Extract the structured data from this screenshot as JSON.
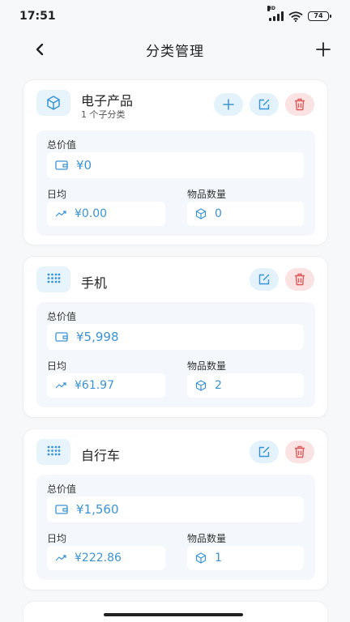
{
  "status": {
    "time": "17:51",
    "network": "HD",
    "battery": "74"
  },
  "header": {
    "title": "分类管理"
  },
  "labels": {
    "total": "总价值",
    "daily": "日均",
    "count": "物品数量"
  },
  "categories": [
    {
      "name": "电子产品",
      "sub": "1 个子分类",
      "icon": "cube-icon",
      "total": "¥0",
      "daily": "¥0.00",
      "count": "0",
      "has_add": true
    },
    {
      "name": "手机",
      "icon": "grid-dots-icon",
      "total": "¥5,998",
      "daily": "¥61.97",
      "count": "2",
      "has_add": false
    },
    {
      "name": "自行车",
      "icon": "grid-dots-icon",
      "total": "¥1,560",
      "daily": "¥222.86",
      "count": "1",
      "has_add": false
    }
  ],
  "colors": {
    "accent": "#3a93d5",
    "danger": "#e0585a",
    "panel": "#f4f8fc"
  }
}
